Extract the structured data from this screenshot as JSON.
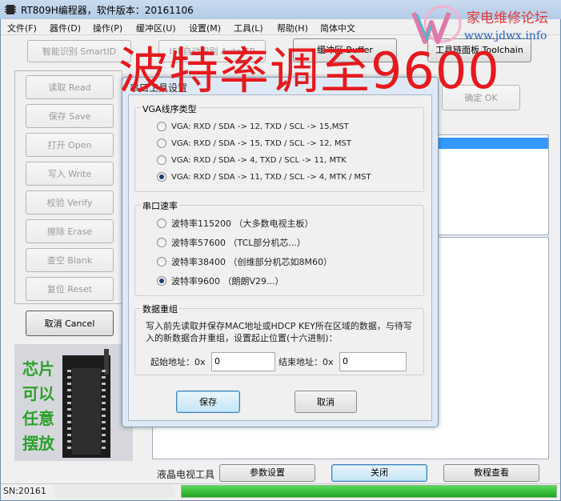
{
  "window": {
    "title": "RT809H编程器，软件版本：20161106",
    "menu": [
      "文件(F)",
      "器件(D)",
      "操作(P)",
      "缓冲区(U)",
      "设置(M)",
      "工具(L)",
      "帮助(H)",
      "简体中文"
    ]
  },
  "toolbar": {
    "smart_id": "智能识别 SmartID",
    "isp_auto": "ISP自动识别 AutoISP",
    "buffer": "缓冲区 Buffer",
    "toolchain": "工具链面板 Toolchain",
    "ok": "确定 OK"
  },
  "side_buttons": {
    "read": "读取 Read",
    "save": "保存 Save",
    "open": "打开 Open",
    "write": "写入 Write",
    "verify": "校验 Verify",
    "erase": "擦除 Erase",
    "blank": "查空 Blank",
    "reset": "复位 Reset",
    "cancel": "取消 Cancel"
  },
  "chip_photo": {
    "caption": [
      "芯片",
      "可以",
      "任意",
      "摆放"
    ]
  },
  "watermark": {
    "cn": "家电维修论坛",
    "url": "www.jdwx.info"
  },
  "overlay": {
    "text": "波特率调至9600"
  },
  "dialog": {
    "title": "串口工具设置",
    "vga_group": "VGA线序类型",
    "vga_options": [
      {
        "label": "VGA: RXD / SDA -> 12, TXD / SCL -> 15,MST",
        "selected": false
      },
      {
        "label": "VGA: RXD / SDA -> 15, TXD / SCL -> 12, MST",
        "selected": false
      },
      {
        "label": "VGA: RXD / SDA ->  4, TXD / SCL -> 11, MTK",
        "selected": false
      },
      {
        "label": "VGA: RXD / SDA -> 11, TXD / SCL ->  4, MTK / MST",
        "selected": true
      }
    ],
    "baud_group": "串口速率",
    "baud_options": [
      {
        "label": "波特率115200 （大多数电视主板）",
        "selected": false
      },
      {
        "label": "波特率57600 （TCL部分机芯...）",
        "selected": false
      },
      {
        "label": "波特率38400 （创维部分机芯如8M60）",
        "selected": false
      },
      {
        "label": "波特率9600 （朗朗V29...）",
        "selected": true
      }
    ],
    "regroup_group": "数据重组",
    "regroup_desc": "写入前先读取并保存MAC地址或HDCP KEY所在区域的数据，与待写入的新数据合并重组，设置起止位置(十六进制)：",
    "start_label": "起始地址：0x",
    "start_value": "0",
    "end_label": "结束地址：0x",
    "end_value": "0",
    "save": "保存",
    "cancel": "取消"
  },
  "bottom_bar": {
    "label": "液晶电视工具",
    "params": "参数设置",
    "close": "关闭",
    "tutorial": "教程查看"
  },
  "status": {
    "sn": "SN:20161"
  },
  "colors": {
    "overlay_red": "#e6191e",
    "chip_text_green": "#2ca02c",
    "progress_green": "#1fa51f"
  }
}
